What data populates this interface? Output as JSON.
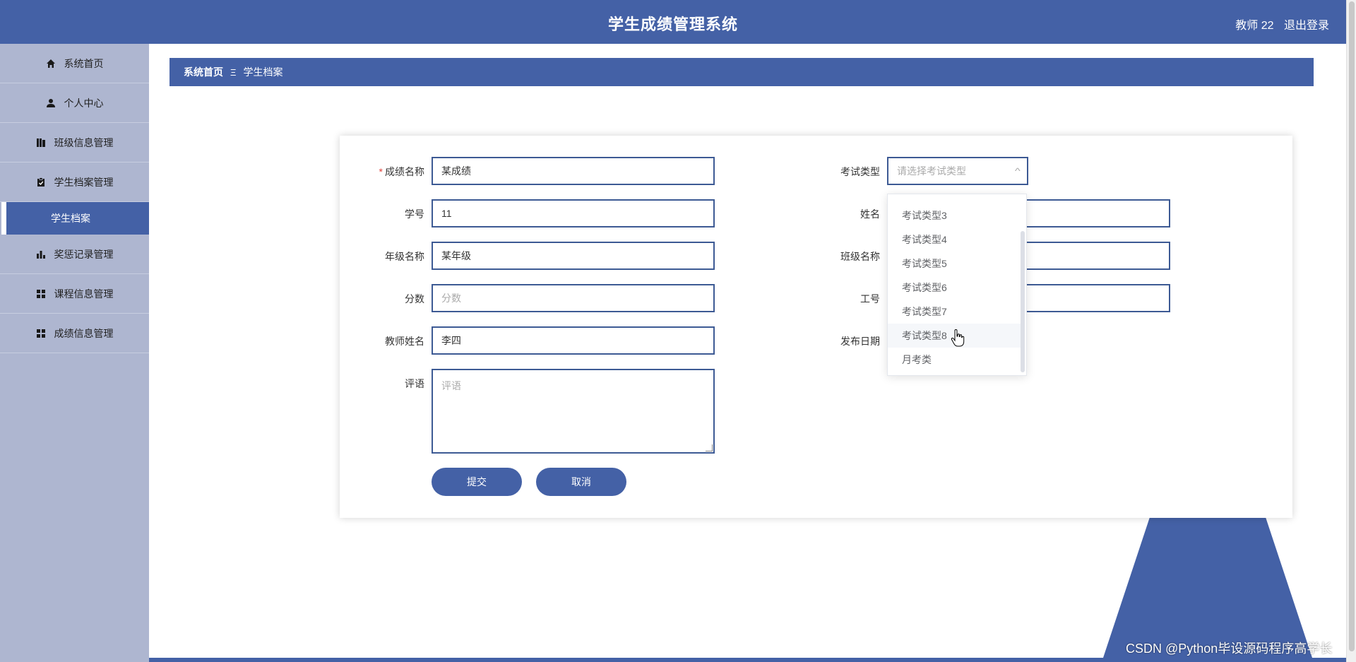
{
  "header": {
    "title": "学生成绩管理系统",
    "user": "教师 22",
    "logout": "退出登录"
  },
  "sidebar": {
    "items": [
      {
        "label": "系统首页",
        "icon": "home-icon"
      },
      {
        "label": "个人中心",
        "icon": "user-icon"
      },
      {
        "label": "班级信息管理",
        "icon": "book-icon"
      },
      {
        "label": "学生档案管理",
        "icon": "clipboard-icon"
      }
    ],
    "sub_item": "学生档案",
    "items2": [
      {
        "label": "奖惩记录管理",
        "icon": "bar-chart-icon"
      },
      {
        "label": "课程信息管理",
        "icon": "grid-icon"
      },
      {
        "label": "成绩信息管理",
        "icon": "grid-icon"
      }
    ]
  },
  "breadcrumb": {
    "home": "系统首页",
    "separator": "Ξ",
    "current": "学生档案"
  },
  "form": {
    "score_name": {
      "label": "成绩名称",
      "value": "某成绩",
      "required": "*"
    },
    "student_no": {
      "label": "学号",
      "value": "11"
    },
    "grade_name": {
      "label": "年级名称",
      "value": "某年级"
    },
    "score": {
      "label": "分数",
      "placeholder": "分数"
    },
    "teacher_name": {
      "label": "教师姓名",
      "value": "李四"
    },
    "comment": {
      "label": "评语",
      "placeholder": "评语"
    },
    "exam_type": {
      "label": "考试类型",
      "placeholder": "请选择考试类型"
    },
    "name": {
      "label": "姓名"
    },
    "class_name": {
      "label": "班级名称"
    },
    "job_no": {
      "label": "工号"
    },
    "publish_date": {
      "label": "发布日期"
    },
    "submit": "提交",
    "cancel": "取消"
  },
  "dropdown": {
    "options": [
      "考试类型3",
      "考试类型4",
      "考试类型5",
      "考试类型6",
      "考试类型7",
      "考试类型8",
      "月考类"
    ],
    "hovered_index": 5
  },
  "watermark": "CSDN @Python毕设源码程序高学长"
}
